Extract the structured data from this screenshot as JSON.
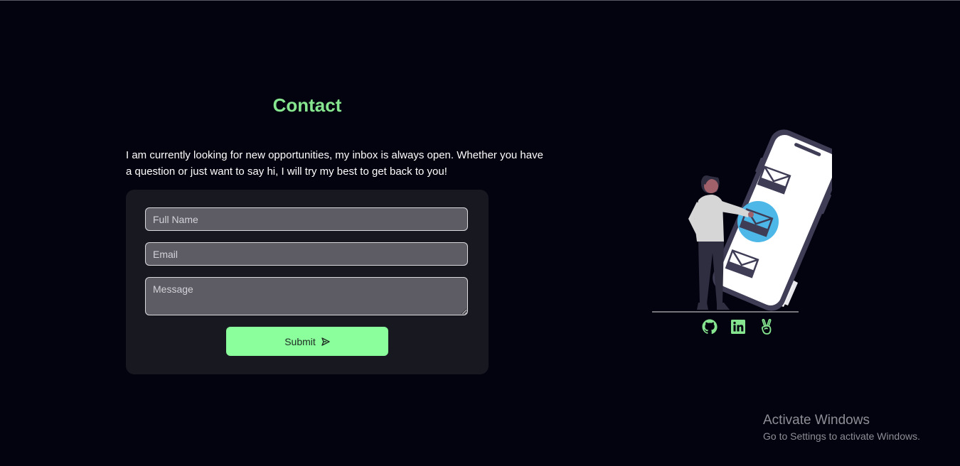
{
  "contact": {
    "title": "Contact",
    "intro": "I am currently looking for new opportunities, my inbox is always open.  Whether you have a question or just want to say hi, I will try my best to get back to you!"
  },
  "form": {
    "name_placeholder": "Full Name",
    "email_placeholder": "Email",
    "message_placeholder": "Message",
    "submit_label": "Submit"
  },
  "socials": [
    {
      "icon": "github-icon"
    },
    {
      "icon": "linkedin-icon"
    },
    {
      "icon": "angellist-icon"
    }
  ],
  "watermark": {
    "title": "Activate Windows",
    "subtitle": "Go to Settings to activate Windows."
  },
  "colors": {
    "background": "#03020f",
    "accent": "#86e58f",
    "button": "#8aff9b",
    "card": "#181821",
    "field": "#5d5c65",
    "illustration_blue": "#4db8e8"
  }
}
